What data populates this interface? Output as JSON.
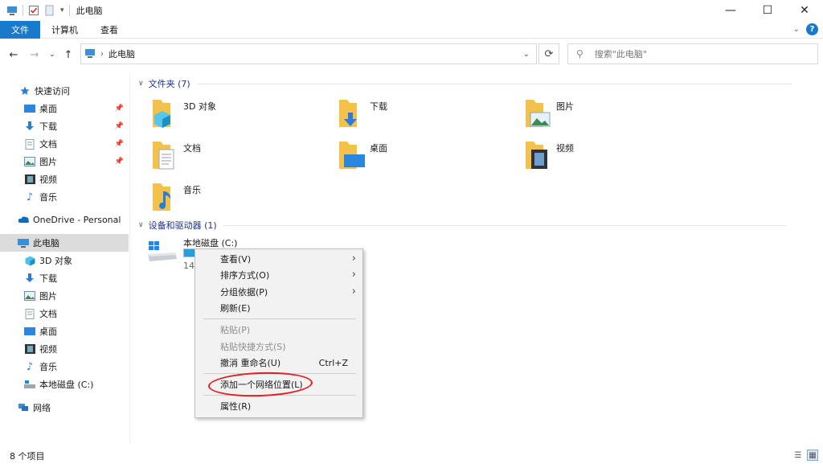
{
  "window": {
    "title": "此电脑",
    "minimize": "—",
    "maximize": "☐",
    "close": "✕"
  },
  "ribbon": {
    "tabs": [
      "文件",
      "计算机",
      "查看"
    ]
  },
  "nav": {
    "address": "此电脑",
    "search_placeholder": "搜索\"此电脑\""
  },
  "sidebar": {
    "quick_access": "快速访问",
    "quick_items": [
      "桌面",
      "下载",
      "文档",
      "图片",
      "视频",
      "音乐"
    ],
    "onedrive": "OneDrive - Personal",
    "this_pc": "此电脑",
    "pc_items": [
      "3D 对象",
      "下载",
      "图片",
      "文档",
      "桌面",
      "视频",
      "音乐",
      "本地磁盘 (C:)"
    ],
    "network": "网络"
  },
  "content": {
    "folders_header": "文件夹 (7)",
    "folders": [
      "3D 对象",
      "下载",
      "图片",
      "文档",
      "桌面",
      "视频",
      "音乐"
    ],
    "devices_header": "设备和驱动器 (1)",
    "drive": {
      "name": "本地磁盘 (C:)",
      "free_text": "14",
      "used_fraction": 0.9
    }
  },
  "context_menu": {
    "items": [
      {
        "label": "查看(V)",
        "submenu": true,
        "disabled": false
      },
      {
        "label": "排序方式(O)",
        "submenu": true,
        "disabled": false
      },
      {
        "label": "分组依据(P)",
        "submenu": true,
        "disabled": false
      },
      {
        "label": "刷新(E)",
        "submenu": false,
        "disabled": false
      },
      {
        "label": "粘贴(P)",
        "submenu": false,
        "disabled": true
      },
      {
        "label": "粘贴快捷方式(S)",
        "submenu": false,
        "disabled": true
      },
      {
        "label": "撤消 重命名(U)",
        "shortcut": "Ctrl+Z",
        "submenu": false,
        "disabled": false
      },
      {
        "label": "添加一个网络位置(L)",
        "submenu": false,
        "disabled": false,
        "highlighted_by_annotation": true
      },
      {
        "label": "属性(R)",
        "submenu": false,
        "disabled": false
      }
    ]
  },
  "status": {
    "count": "8 个项目"
  },
  "colors": {
    "accent": "#1979ca",
    "annotation": "#e02020",
    "folder": "#f3c24a"
  }
}
